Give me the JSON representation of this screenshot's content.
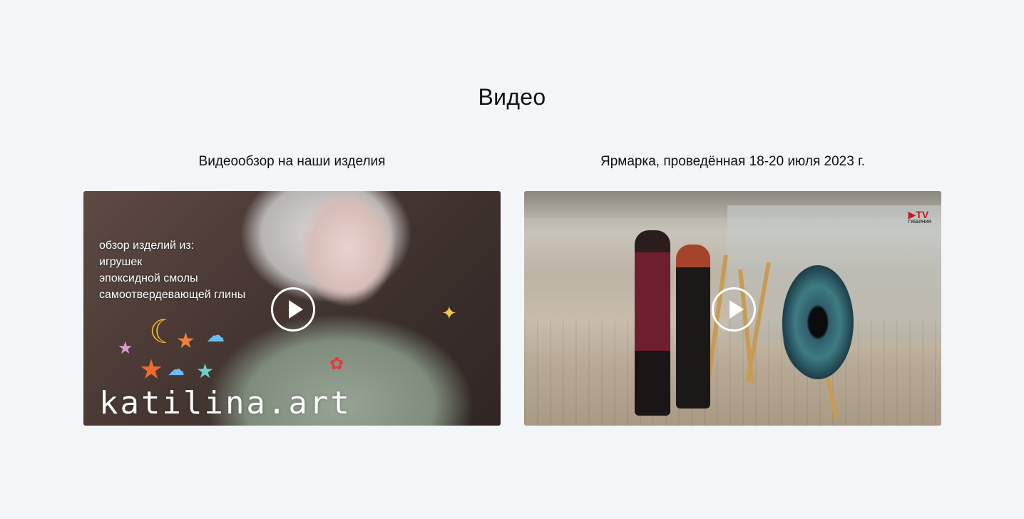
{
  "section": {
    "title": "Видео"
  },
  "videos": [
    {
      "caption": "Видеообзор на наши изделия",
      "overlay_lines": [
        "обзор изделий из:",
        "игрушек",
        "эпоксидной смолы",
        "самоотвердевающей глины"
      ],
      "watermark": "katilina.art",
      "play_icon": "play-icon"
    },
    {
      "caption": "Ярмарка, проведённая 18-20 июля 2023 г.",
      "channel_logo": "TV",
      "channel_logo_sub": "ГУБЕРНИЯ",
      "play_icon": "play-icon"
    }
  ],
  "colors": {
    "page_background": "#f2f6f9",
    "text": "#111111",
    "play_button": "#ffffff",
    "channel_logo": "#c8161d"
  }
}
